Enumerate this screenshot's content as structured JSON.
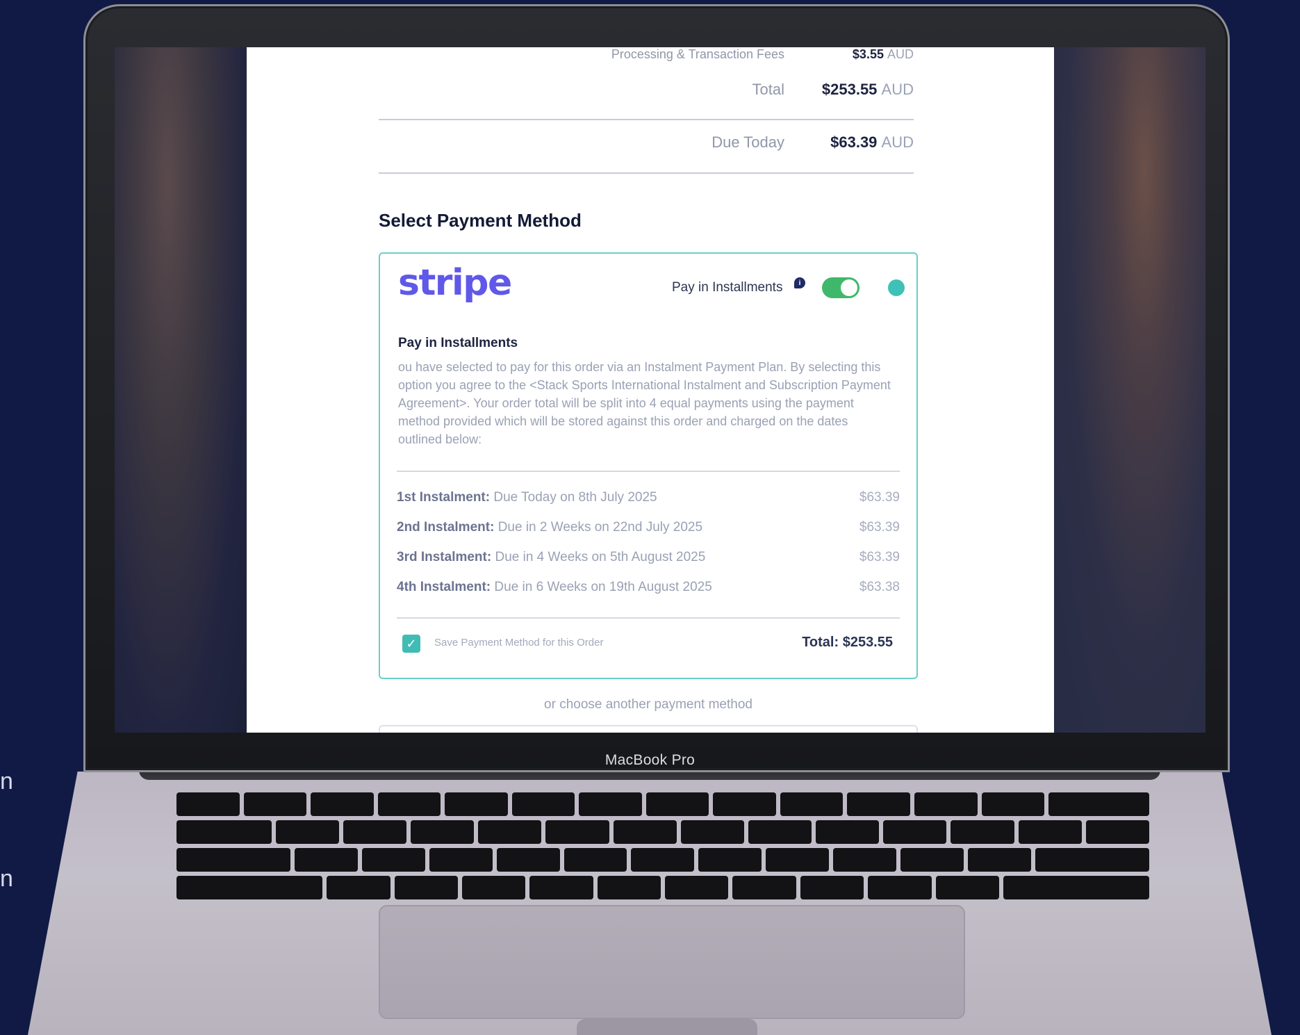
{
  "summary": {
    "fees": {
      "label": "Processing & Transaction Fees",
      "amount": "$3.55",
      "currency": "AUD"
    },
    "total": {
      "label": "Total",
      "amount": "$253.55",
      "currency": "AUD"
    },
    "due_today": {
      "label": "Due Today",
      "amount": "$63.39",
      "currency": "AUD"
    }
  },
  "payment": {
    "section_title": "Select Payment Method",
    "provider_logo": "stripe",
    "installments_toggle_label": "Pay in Installments",
    "installments_toggle_on": true,
    "plan_title": "Pay in Installments",
    "plan_description": "ou have selected to pay for this order via an Instalment Payment Plan. By selecting this option you agree to the <Stack Sports International Instalment and Subscription Payment Agreement>. Your order total will be split into 4 equal payments using the payment method provided which will be stored against this order and charged on the dates outlined below:",
    "instalments": [
      {
        "name": "1st Instalment:",
        "detail": "Due Today on 8th July 2025",
        "amount": "$63.39"
      },
      {
        "name": "2nd Instalment:",
        "detail": "Due in 2 Weeks on 22nd July 2025",
        "amount": "$63.39"
      },
      {
        "name": "3rd Instalment:",
        "detail": "Due in 4 Weeks on 5th August 2025",
        "amount": "$63.39"
      },
      {
        "name": "4th Instalment:",
        "detail": "Due in 6 Weeks on 19th August 2025",
        "amount": "$63.38"
      }
    ],
    "save_method_label": "Save Payment Method for this Order",
    "save_method_checked": true,
    "card_total": "Total: $253.55",
    "other_method_text": "or choose another payment method"
  },
  "device": {
    "bezel_label": "MacBook Pro"
  },
  "edge_text": [
    "n",
    "n"
  ],
  "colors": {
    "background": "#111a45",
    "card_border": "#6ad0c6",
    "stripe_brand": "#6058e8",
    "toggle_on": "#3fb86b",
    "checkbox": "#3fbcb4"
  }
}
